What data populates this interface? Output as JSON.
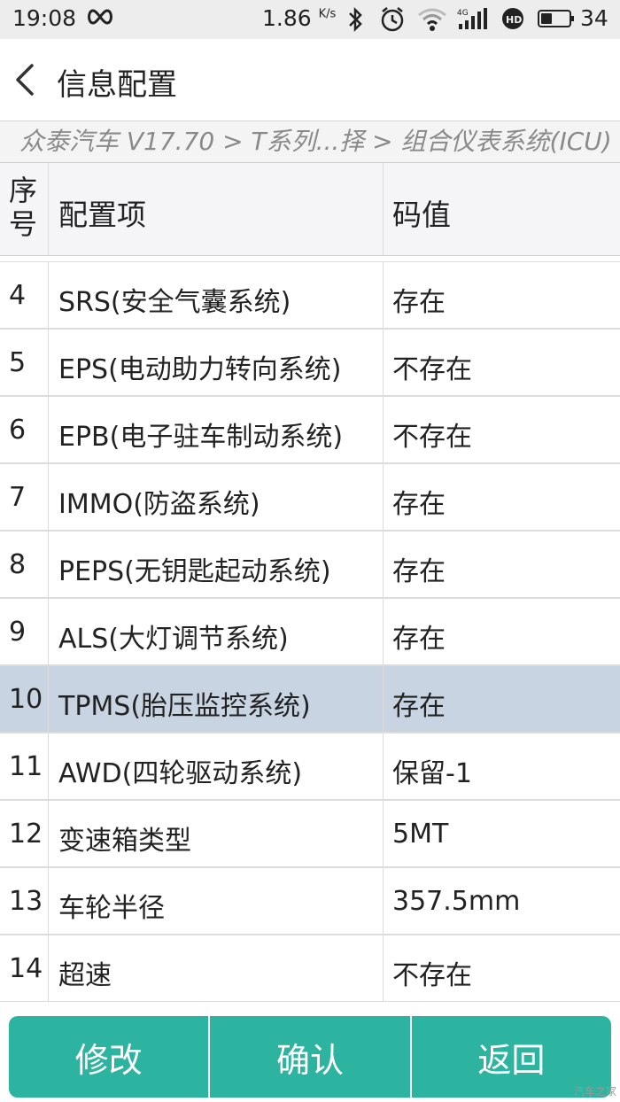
{
  "status_bar": {
    "time": "19:08",
    "speed": "1.86",
    "speed_unit": "K/s",
    "battery": "34",
    "network": "4G"
  },
  "header": {
    "title": "信息配置"
  },
  "breadcrumb": "众泰汽车 V17.70 > T系列...择 > 组合仪表系统(ICU)",
  "table": {
    "columns": [
      "序号",
      "配置项",
      "码值"
    ],
    "rows": [
      {
        "index": "4",
        "item": "SRS(安全气囊系统)",
        "value": "存在"
      },
      {
        "index": "5",
        "item": "EPS(电动助力转向系统)",
        "value": "不存在"
      },
      {
        "index": "6",
        "item": "EPB(电子驻车制动系统)",
        "value": "不存在"
      },
      {
        "index": "7",
        "item": "IMMO(防盗系统)",
        "value": "存在"
      },
      {
        "index": "8",
        "item": "PEPS(无钥匙起动系统)",
        "value": "存在"
      },
      {
        "index": "9",
        "item": "ALS(大灯调节系统)",
        "value": "存在"
      },
      {
        "index": "10",
        "item": "TPMS(胎压监控系统)",
        "value": "存在"
      },
      {
        "index": "11",
        "item": "AWD(四轮驱动系统)",
        "value": "保留-1"
      },
      {
        "index": "12",
        "item": "变速箱类型",
        "value": "5MT"
      },
      {
        "index": "13",
        "item": "车轮半径",
        "value": "357.5mm"
      },
      {
        "index": "14",
        "item": "超速",
        "value": "不存在"
      }
    ],
    "selected_index": "10"
  },
  "footer": {
    "modify_label": "修改",
    "confirm_label": "确认",
    "back_label": "返回"
  },
  "watermark": "汽车之家",
  "colors": {
    "accent": "#2cb4a0",
    "selected_row": "#c8d4e2",
    "status_bar_bg": "#ededed"
  },
  "icons": [
    "infinity-icon",
    "bluetooth-icon",
    "alarm-icon",
    "wifi-icon",
    "signal-icon",
    "hd-icon",
    "battery-icon",
    "back-arrow-icon"
  ]
}
